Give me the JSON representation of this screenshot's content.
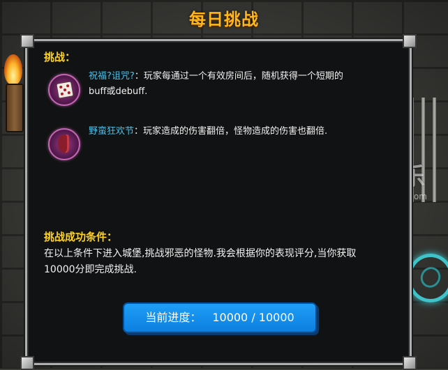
{
  "title": "每日挑战",
  "challenge_heading": "挑战：",
  "rules": [
    {
      "name": "祝福?诅咒?",
      "line1": "：玩家每通过一个有效房间后，随机获得一个短期的",
      "line2": "buff或debuff.",
      "icon": "dice-icon"
    },
    {
      "name": "野蛮狂欢节",
      "line1": "：玩家造成的伤害翻倍，怪物造成的伤害也翻倍.",
      "icon": "axe-icon"
    }
  ],
  "condition_heading": "挑战成功条件：",
  "condition_line1": "在以上条件下进入城堡,挑战邪恶的怪物.我会根据你的表现评分,当你获取",
  "condition_line2": "10000分即完成挑战.",
  "progress": {
    "label": "当前进度：",
    "value": "10000 / 10000"
  },
  "watermark": {
    "main": "触乐",
    "sub": "chuapp.com"
  },
  "colors": {
    "title": "#ffb51c",
    "heading": "#ffd21e",
    "rule_name": "#4fc1ea",
    "progress_button": "#1f9ef7"
  }
}
